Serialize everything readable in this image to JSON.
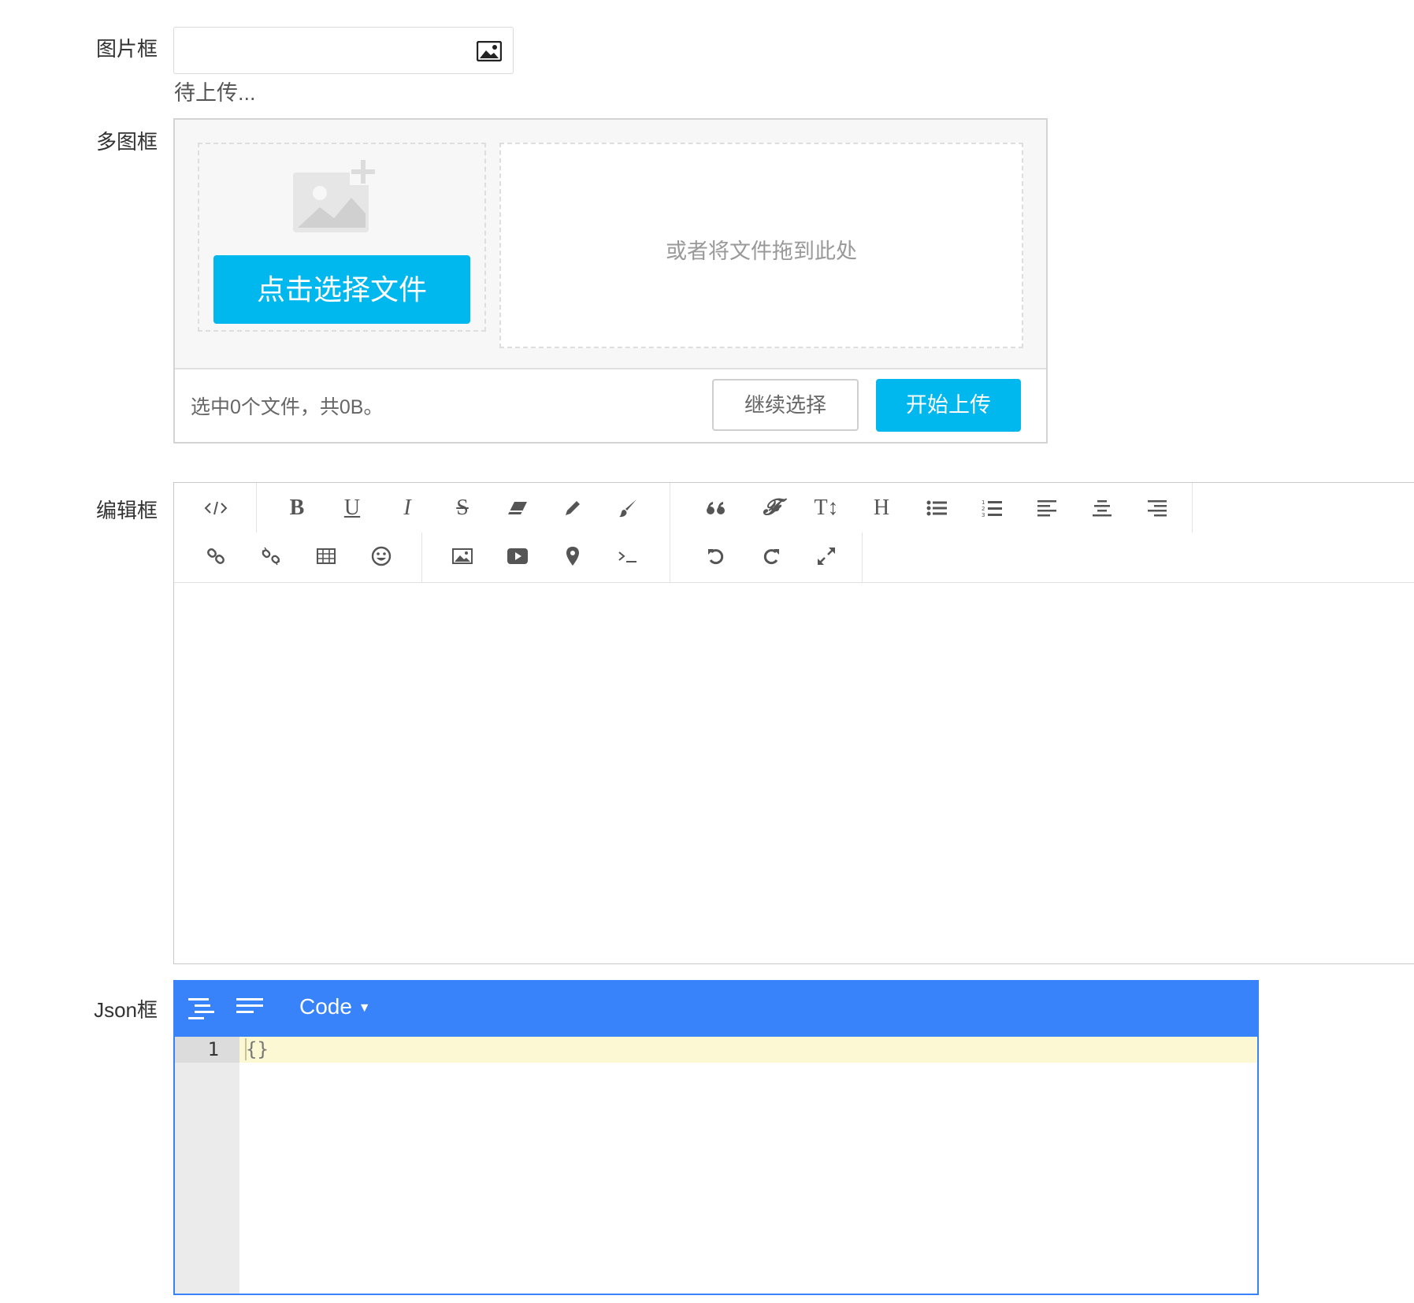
{
  "labels": {
    "image": "图片框",
    "multi": "多图框",
    "editor": "编辑框",
    "json": "Json框"
  },
  "image_field": {
    "value": "",
    "status": "待上传...",
    "icon": "image-icon"
  },
  "multi_upload": {
    "pick_label": "点击选择文件",
    "drop_hint": "或者将文件拖到此处",
    "summary": "选中0个文件，共0B。",
    "continue_label": "继续选择",
    "start_label": "开始上传",
    "accent": "#00b7ee"
  },
  "editor": {
    "toolbar_row1": [
      "code-view",
      "bold",
      "underline",
      "italic",
      "strikethrough",
      "eraser",
      "pencil",
      "paint-brush",
      "quote",
      "font-family",
      "font-size",
      "heading",
      "unordered-list",
      "ordered-list",
      "align-left",
      "align-center",
      "align-right"
    ],
    "toolbar_row2": [
      "link",
      "unlink",
      "table",
      "emoticon",
      "image",
      "video",
      "map-marker",
      "terminal",
      "undo",
      "redo",
      "fullscreen"
    ],
    "content": ""
  },
  "json_editor": {
    "mode": "Code",
    "line_numbers": [
      "1"
    ],
    "code": "{}",
    "accent": "#3883fa"
  }
}
